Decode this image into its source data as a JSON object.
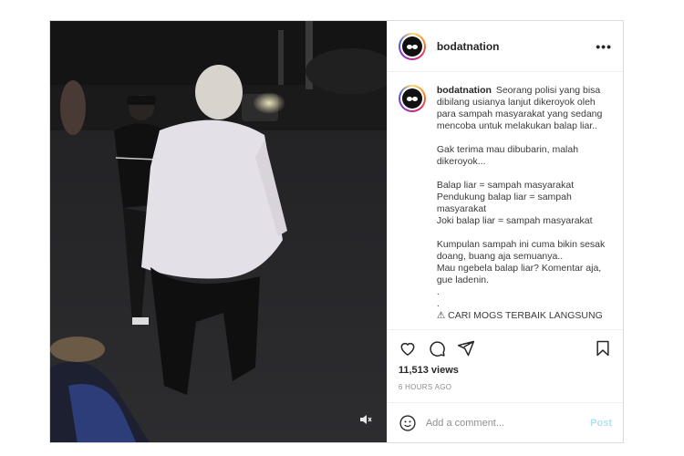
{
  "post": {
    "username": "bodatnation",
    "more_icon": "more-horizontal-icon",
    "caption_username": "bodatnation",
    "caption": "Seorang polisi yang bisa dibilang usianya lanjut dikeroyok oleh para sampah masyarakat yang sedang mencoba untuk melakukan balap liar..\n\nGak terima mau dibubarin, malah dikeroyok...\n\nBalap liar = sampah masyarakat\nPendukung balap liar = sampah masyarakat\nJoki balap liar = sampah masyarakat\n\nKumpulan sampah ini cuma bikin sesak doang, buang aja semuanya..\nMau ngebela balap liar? Komentar aja, gue ladenin.\n.\n.\n⚠ CARI MOGS TERBAIK LANGSUNG",
    "views": "11,513 views",
    "time_ago": "6 HOURS AGO"
  },
  "actions": {
    "icons": [
      "heart-icon",
      "comment-icon",
      "share-icon",
      "bookmark-icon"
    ]
  },
  "comment": {
    "placeholder": "Add a comment...",
    "post_label": "Post",
    "emoji_icon": "emoji-icon"
  },
  "video": {
    "mute_icon": "muted-speaker-icon"
  },
  "colors": {
    "border": "#dbdbdb",
    "text": "#262626",
    "muted": "#8e8e8e",
    "post_disabled": "#b2dffc"
  }
}
